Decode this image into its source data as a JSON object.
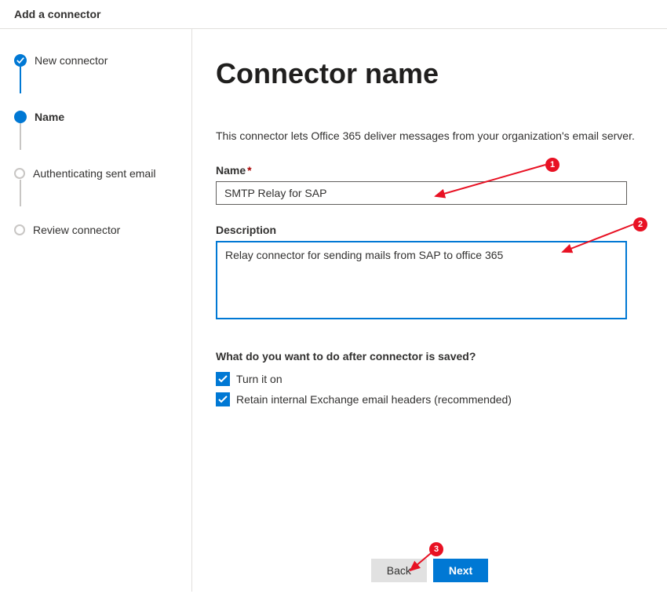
{
  "header": {
    "title": "Add a connector"
  },
  "sidebar": {
    "steps": [
      {
        "label": "New connector",
        "state": "completed"
      },
      {
        "label": "Name",
        "state": "current"
      },
      {
        "label": "Authenticating sent email",
        "state": "upcoming"
      },
      {
        "label": "Review connector",
        "state": "upcoming"
      }
    ]
  },
  "main": {
    "title": "Connector name",
    "intro": "This connector lets Office 365 deliver messages from your organization's email server.",
    "name_label": "Name",
    "name_value": "SMTP Relay for SAP",
    "description_label": "Description",
    "description_value": "Relay connector for sending mails from SAP to office 365",
    "after_save_question": "What do you want to do after connector is saved?",
    "checkboxes": [
      {
        "label": "Turn it on",
        "checked": true
      },
      {
        "label": "Retain internal Exchange email headers (recommended)",
        "checked": true
      }
    ]
  },
  "footer": {
    "back_label": "Back",
    "next_label": "Next"
  },
  "annotations": {
    "badge1": "1",
    "badge2": "2",
    "badge3": "3"
  }
}
